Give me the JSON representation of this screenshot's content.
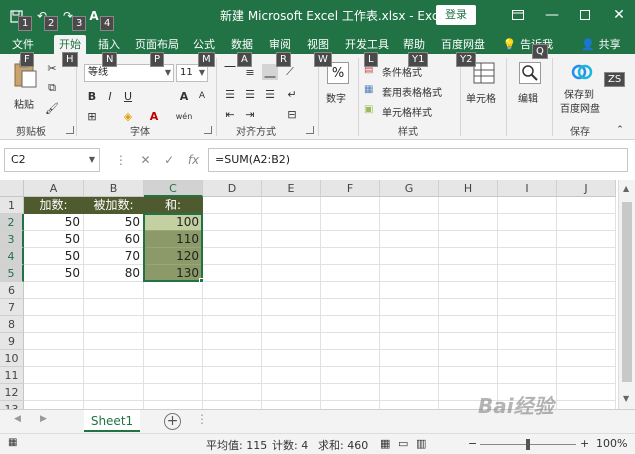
{
  "app": {
    "title": "新建 Microsoft Excel 工作表.xlsx  -  Excel",
    "login": "登录",
    "accent": "#217346"
  },
  "keytips": {
    "qat1": "1",
    "qat2": "2",
    "qat3": "3",
    "qat4": "4",
    "file": "F",
    "home": "H",
    "insert": "N",
    "layout": "P",
    "formula": "M",
    "data": "A",
    "review": "R",
    "view": "W",
    "dev": "L",
    "help": "Y1",
    "baidu": "Y2",
    "tell": "Q",
    "share": "ZS"
  },
  "tabs": [
    "文件",
    "开始",
    "插入",
    "页面布局",
    "公式",
    "数据",
    "审阅",
    "视图",
    "开发工具",
    "帮助",
    "百度网盘",
    "告诉我",
    "共享"
  ],
  "ribbon": {
    "paste": "粘贴",
    "clipboard": "剪贴板",
    "font_name": "等线",
    "font_size": "11",
    "font_group": "字体",
    "bold": "B",
    "italic": "I",
    "underline": "U",
    "wen": "wén",
    "align_group": "对齐方式",
    "number_symbol": "%",
    "number": "数字",
    "cond_format": "条件格式",
    "table_format": "套用表格格式",
    "cell_style": "单元格样式",
    "style_group": "样式",
    "cells": "单元格",
    "edit": "编辑",
    "save_baidu_1": "保存到",
    "save_baidu_2": "百度网盘",
    "save_group": "保存"
  },
  "formula_bar": {
    "name_box": "C2",
    "fx": "fx",
    "formula": "=SUM(A2:B2)"
  },
  "grid": {
    "columns": [
      "A",
      "B",
      "C",
      "D",
      "E",
      "F",
      "G",
      "H",
      "I",
      "J"
    ],
    "rows": [
      "1",
      "2",
      "3",
      "4",
      "5",
      "6",
      "7",
      "8",
      "9",
      "10",
      "11",
      "12",
      "13"
    ],
    "header_row": [
      "加数:",
      "被加数:",
      "和:"
    ],
    "data_rows": [
      [
        "50",
        "50",
        "100"
      ],
      [
        "50",
        "60",
        "110"
      ],
      [
        "50",
        "70",
        "120"
      ],
      [
        "50",
        "80",
        "130"
      ]
    ]
  },
  "sheets": [
    "Sheet1"
  ],
  "status": {
    "average": "平均值: 115",
    "count": "计数: 4",
    "sum": "求和: 460",
    "zoom": "100%"
  },
  "watermark": "Bai经验"
}
